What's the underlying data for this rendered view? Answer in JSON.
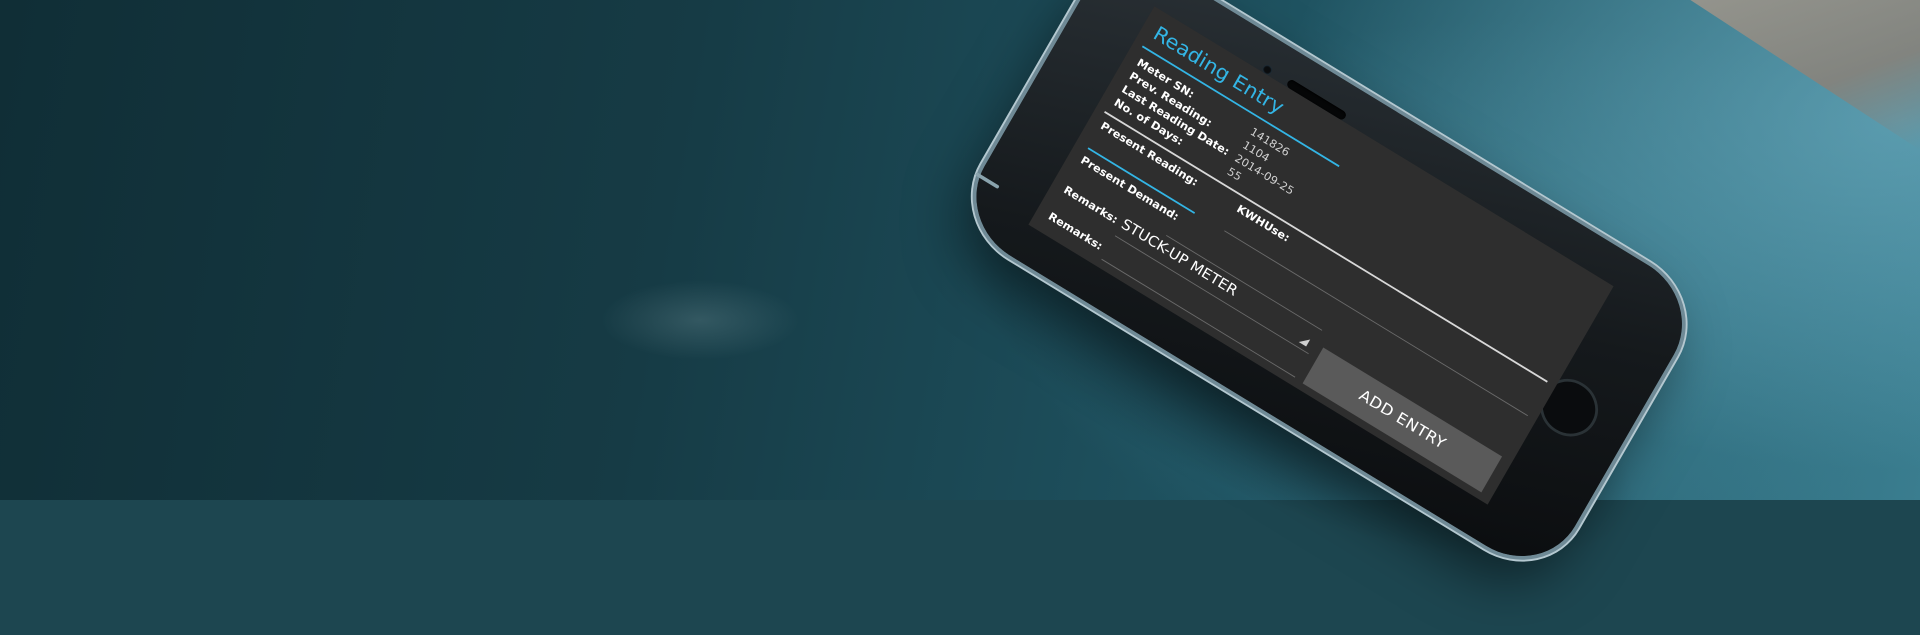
{
  "screen": {
    "title": "Reading Entry",
    "info": [
      {
        "label": "Meter SN:",
        "value": "141826"
      },
      {
        "label": "Prev. Reading:",
        "value": "1104"
      },
      {
        "label": "Last Reading Date:",
        "value": "2014-09-25"
      },
      {
        "label": "No. of Days:",
        "value": "55"
      }
    ],
    "fields": {
      "present_reading": {
        "label": "Present Reading:",
        "value": ""
      },
      "kwh_use": {
        "label": "KWHUse:",
        "value": ""
      },
      "present_demand": {
        "label": "Present Demand:",
        "value": ""
      },
      "remarks_select": {
        "label": "Remarks:",
        "value": "STUCK-UP METER"
      },
      "remarks_text": {
        "label": "Remarks:",
        "value": ""
      }
    },
    "add_button": "ADD ENTRY",
    "accent_color": "#33b5e5"
  }
}
